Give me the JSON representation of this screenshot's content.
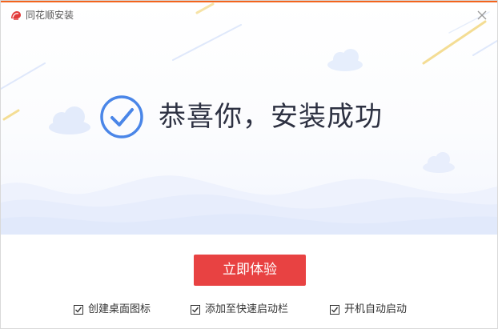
{
  "window": {
    "title": "同花顺安装",
    "app_icon": "tonghuashun-logo-icon",
    "close_icon": "close-icon"
  },
  "hero": {
    "status_icon": "check-circle-icon",
    "message": "恭喜你，安装成功"
  },
  "actions": {
    "primary_label": "立即体验"
  },
  "options": [
    {
      "label": "创建桌面图标",
      "checked": true
    },
    {
      "label": "添加至快速启动栏",
      "checked": true
    },
    {
      "label": "开机自动启动",
      "checked": true
    }
  ],
  "colors": {
    "accent_orange": "#f3641d",
    "primary_red": "#e84242",
    "check_blue": "#4a86e8",
    "text_dark": "#2d3142"
  }
}
